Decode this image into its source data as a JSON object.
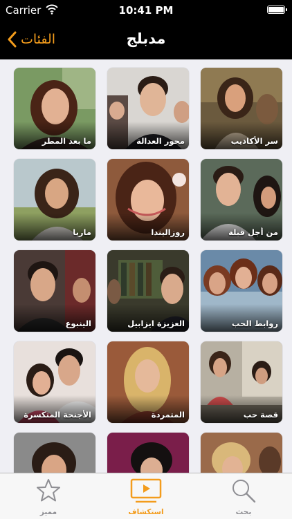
{
  "status_bar": {
    "carrier": "Carrier",
    "time": "10:41 PM"
  },
  "nav": {
    "back_label": "الفئات",
    "title": "مدبلج"
  },
  "tiles": [
    {
      "label": "ما بعد المطر"
    },
    {
      "label": "محور العدالة"
    },
    {
      "label": "سر الأكاذيب"
    },
    {
      "label": "ماريا"
    },
    {
      "label": "روزاليندا"
    },
    {
      "label": "من أجل قبلة"
    },
    {
      "label": "الينبوع"
    },
    {
      "label": "العزيزة ايزابيل"
    },
    {
      "label": "روابط الحب"
    },
    {
      "label": "الأجنحة المتكسرة"
    },
    {
      "label": "المتمردة"
    },
    {
      "label": "قصة حب"
    },
    {
      "label": ""
    },
    {
      "label": ""
    },
    {
      "label": ""
    }
  ],
  "tab_bar": {
    "featured": "مميز",
    "explore": "استكشاف",
    "search": "بحث"
  },
  "colors": {
    "accent": "#f39c1c",
    "tab_inactive": "#8e8e93"
  }
}
